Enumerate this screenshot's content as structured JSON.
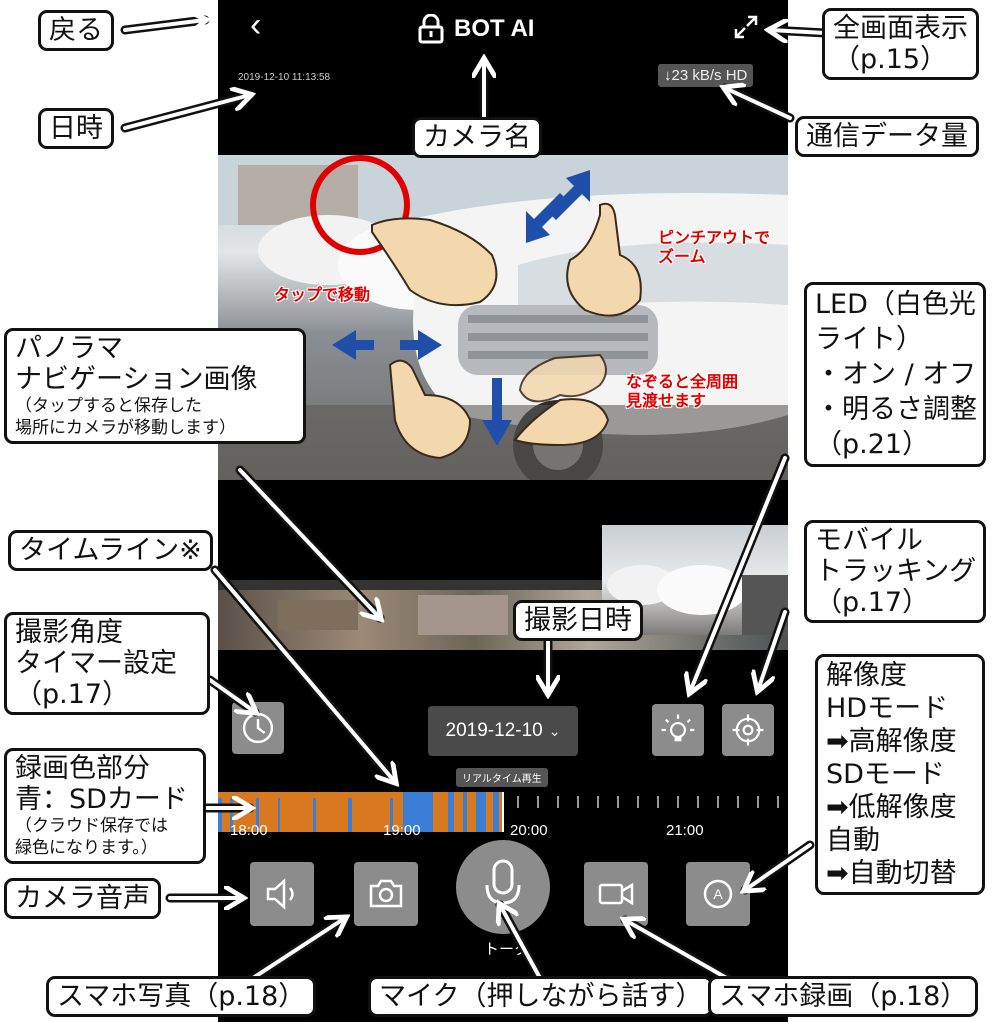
{
  "app": {
    "camera_name": "BOT AI",
    "timestamp": "2019-12-10 11:13:58",
    "bitrate": "↓23 kB/s HD",
    "date_button": "2019-12-10",
    "realtime_tag": "リアルタイム再生",
    "talk_label": "トーク",
    "timeline_times": [
      "18:00",
      "19:00",
      "20:00",
      "21:00"
    ]
  },
  "gestures": {
    "tap": "タップで移動",
    "pinch": "ピンチアウトで\nズーム",
    "swipe": "なぞると全周囲\n見渡せます"
  },
  "callouts": {
    "back": "戻る",
    "fullscreen": "全画面表示\n（p.15）",
    "datetime": "日時",
    "camera_name": "カメラ名",
    "data_rate": "通信データ量",
    "panorama_title": "パノラマ\nナビゲーション画像",
    "panorama_note": "（タップすると保存した\n場所にカメラが移動します）",
    "led": "LED（白色光\nライト）\n・オン / オフ\n・明るさ調整\n（p.21）",
    "timeline": "タイムライン※",
    "tracking": "モバイル\nトラッキング\n（p.17）",
    "shoot_datetime": "撮影日時",
    "angle_timer": "撮影角度\nタイマー設定\n（p.17）",
    "resolution": "解像度\nHDモード\n➡高解像度\nSDモード\n➡低解像度\n自動\n➡自動切替",
    "recording_title": "録画色部分\n青：SDカード",
    "recording_note": "（クラウド保存では\n緑色になります。）",
    "camera_audio": "カメラ音声",
    "phone_photo": "スマホ写真（p.18）",
    "mic": "マイク（押しながら話す）",
    "phone_record": "スマホ録画（p.18）"
  },
  "colors": {
    "accent_red": "#e00000",
    "arrow_blue": "#1f4fa8",
    "timeline_orange": "#d9791f",
    "timeline_blue": "#3a7fd5",
    "button_gray": "#8c8c8c"
  }
}
